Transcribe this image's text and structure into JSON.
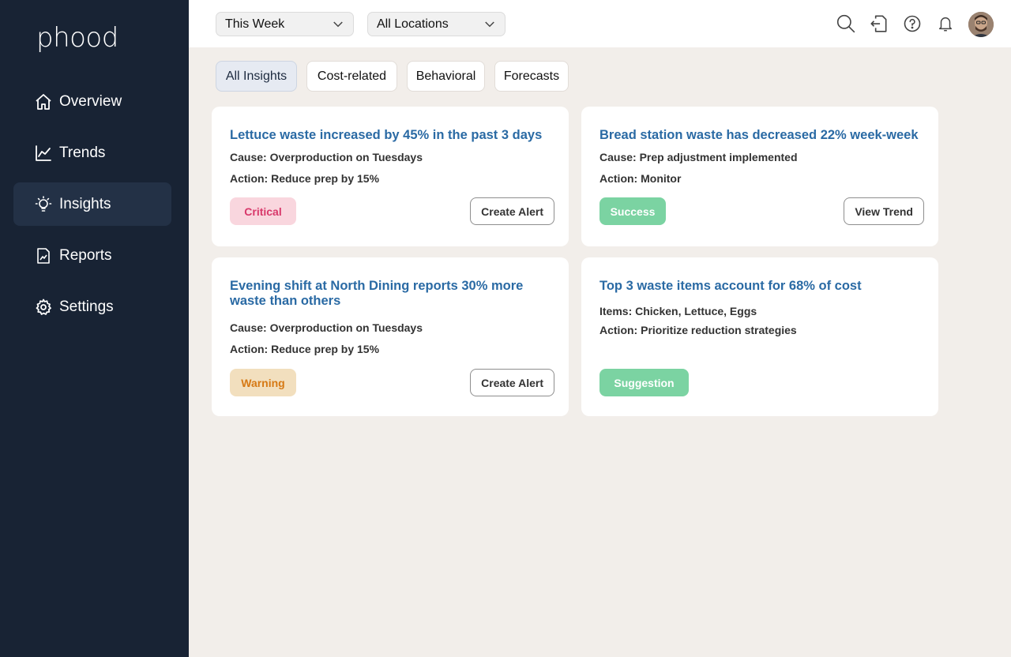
{
  "app": {
    "logo": "phood"
  },
  "sidebar": {
    "items": [
      {
        "label": "Overview",
        "icon": "home-icon"
      },
      {
        "label": "Trends",
        "icon": "line-chart-icon"
      },
      {
        "label": "Insights",
        "icon": "lightbulb-icon",
        "active": true
      },
      {
        "label": "Reports",
        "icon": "report-file-icon"
      },
      {
        "label": "Settings",
        "icon": "gear-icon"
      }
    ]
  },
  "topbar": {
    "period_select": "This Week",
    "location_select": "All Locations",
    "icons": [
      "search-icon",
      "export-icon",
      "help-icon",
      "bell-icon",
      "avatar"
    ]
  },
  "tabs": [
    {
      "label": "All Insights",
      "active": true
    },
    {
      "label": "Cost-related"
    },
    {
      "label": "Behavioral"
    },
    {
      "label": "Forecasts"
    }
  ],
  "cards": [
    {
      "title": "Lettuce waste increased by 45% in the past 3 days",
      "line1": "Cause: Overproduction on Tuesdays",
      "line2": "Action: Reduce prep by 15%",
      "badge": "Critical",
      "button": "Create Alert"
    },
    {
      "title": "Bread station waste has decreased 22% week-week",
      "line1": "Cause: Prep adjustment implemented",
      "line2": "Action: Monitor",
      "badge": "Success",
      "button": "View Trend"
    },
    {
      "title": "Evening shift at North Dining reports 30% more waste than others",
      "line1": "Cause: Overproduction on Tuesdays",
      "line2": "Action: Reduce prep by 15%",
      "badge": "Warning",
      "button": "Create Alert"
    },
    {
      "title": "Top 3 waste items account for 68% of cost",
      "line1": "Items: Chicken, Lettuce, Eggs",
      "line2": "Action: Prioritize reduction strategies",
      "badge": "Suggestion"
    }
  ],
  "colors": {
    "sidebar_bg": "#182334",
    "title_blue": "#2a6aa4",
    "critical": "#d8386a",
    "success": "#7bd3a2",
    "warning": "#d67914"
  }
}
